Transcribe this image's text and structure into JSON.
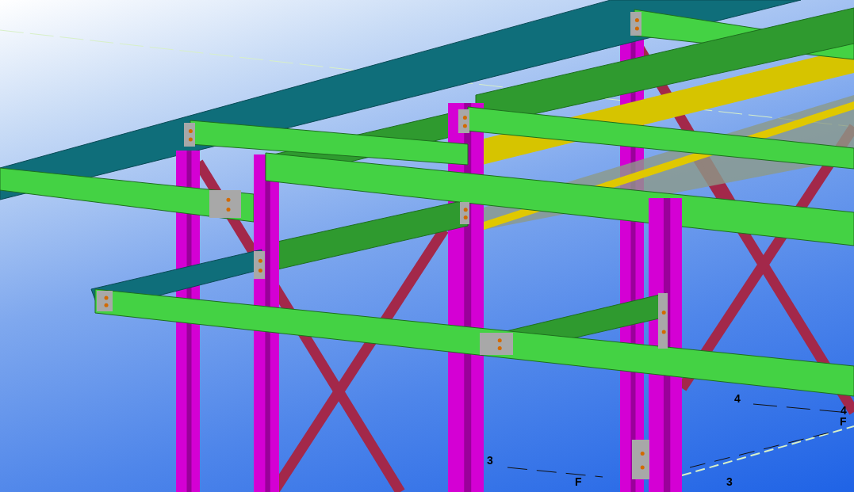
{
  "viewport": {
    "grid_labels": [
      {
        "text": "4"
      },
      {
        "text": "4"
      },
      {
        "text": "F"
      },
      {
        "text": "3"
      },
      {
        "text": "F"
      },
      {
        "text": "3"
      }
    ]
  }
}
